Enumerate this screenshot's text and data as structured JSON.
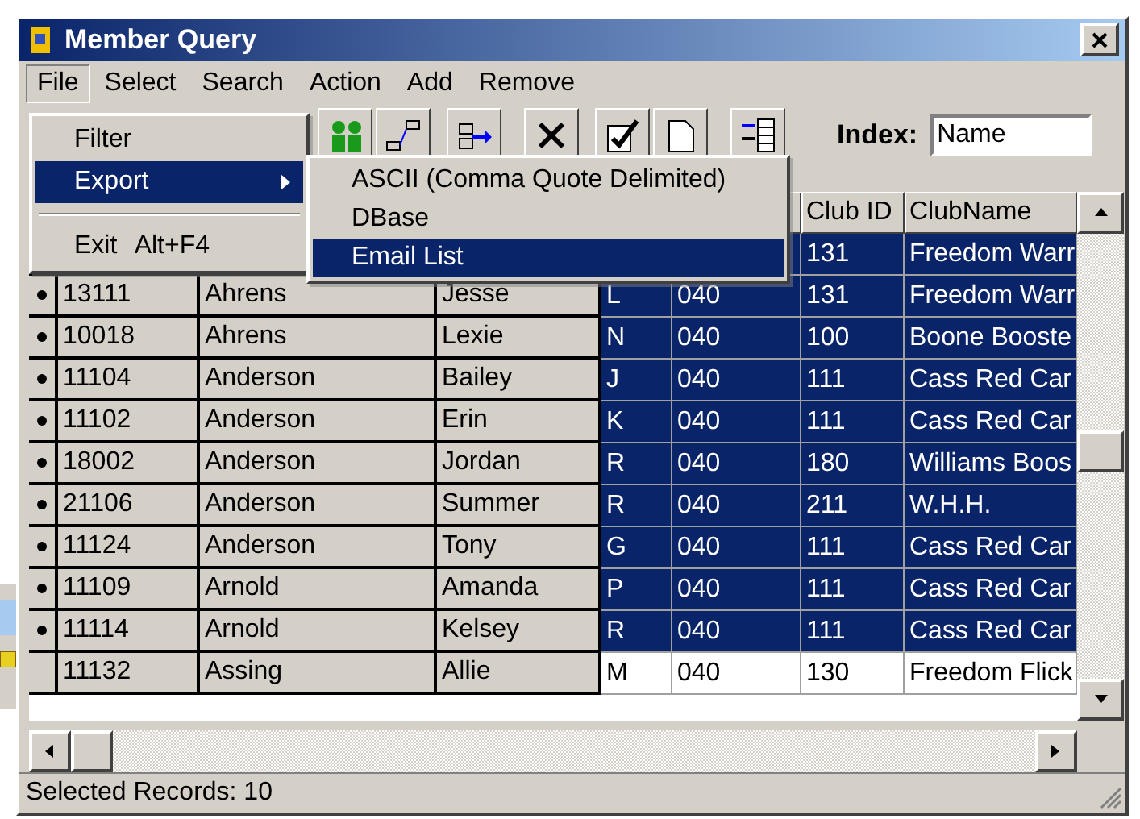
{
  "window": {
    "title": "Member Query"
  },
  "menu_bar": {
    "items": [
      {
        "label": "File",
        "selected": true
      },
      {
        "label": "Select",
        "selected": false
      },
      {
        "label": "Search",
        "selected": false
      },
      {
        "label": "Action",
        "selected": false
      },
      {
        "label": "Add",
        "selected": false
      },
      {
        "label": "Remove",
        "selected": false
      }
    ]
  },
  "file_menu": {
    "items": [
      {
        "kind": "item",
        "label": "Filter",
        "selected": false
      },
      {
        "kind": "submenu",
        "label": "Export",
        "selected": true
      },
      {
        "kind": "separator"
      },
      {
        "kind": "item",
        "label": "Exit",
        "shortcut": "Alt+F4",
        "selected": false
      }
    ]
  },
  "export_submenu": {
    "items": [
      {
        "label": "ASCII (Comma Quote Delimited)",
        "selected": false
      },
      {
        "label": "DBase",
        "selected": false
      },
      {
        "label": "Email List",
        "selected": true
      }
    ]
  },
  "toolbar": {
    "index_label": "Index:",
    "index_value": "Name"
  },
  "grid": {
    "columns": {
      "column_6": "Club ID",
      "column_7": "ClubName"
    },
    "rows": [
      {
        "selected": true,
        "column_6": "131",
        "column_7": "Freedom Warr"
      },
      {
        "marked": true,
        "selected": true,
        "column_1": "13111",
        "column_2": "Ahrens",
        "column_3": "Jesse",
        "column_4": "L",
        "column_5": "040",
        "column_6": "131",
        "column_7": "Freedom Warr"
      },
      {
        "marked": true,
        "selected": true,
        "column_1": "10018",
        "column_2": "Ahrens",
        "column_3": "Lexie",
        "column_4": "N",
        "column_5": "040",
        "column_6": "100",
        "column_7": "Boone Booste"
      },
      {
        "marked": true,
        "selected": true,
        "column_1": "11104",
        "column_2": "Anderson",
        "column_3": "Bailey",
        "column_4": "J",
        "column_5": "040",
        "column_6": "111",
        "column_7": "Cass Red Car"
      },
      {
        "marked": true,
        "selected": true,
        "column_1": "11102",
        "column_2": "Anderson",
        "column_3": "Erin",
        "column_4": "K",
        "column_5": "040",
        "column_6": "111",
        "column_7": "Cass Red Car"
      },
      {
        "marked": true,
        "selected": true,
        "column_1": "18002",
        "column_2": "Anderson",
        "column_3": "Jordan",
        "column_4": "R",
        "column_5": "040",
        "column_6": "180",
        "column_7": "Williams Boos"
      },
      {
        "marked": true,
        "selected": true,
        "column_1": "21106",
        "column_2": "Anderson",
        "column_3": "Summer",
        "column_4": "R",
        "column_5": "040",
        "column_6": "211",
        "column_7": "W.H.H."
      },
      {
        "marked": true,
        "selected": true,
        "column_1": "11124",
        "column_2": "Anderson",
        "column_3": "Tony",
        "column_4": "G",
        "column_5": "040",
        "column_6": "111",
        "column_7": "Cass Red Car"
      },
      {
        "marked": true,
        "selected": true,
        "column_1": "11109",
        "column_2": "Arnold",
        "column_3": "Amanda",
        "column_4": "P",
        "column_5": "040",
        "column_6": "111",
        "column_7": "Cass Red Car"
      },
      {
        "marked": true,
        "selected": true,
        "column_1": "11114",
        "column_2": "Arnold",
        "column_3": "Kelsey",
        "column_4": "R",
        "column_5": "040",
        "column_6": "111",
        "column_7": "Cass Red Car"
      },
      {
        "marked": false,
        "selected": false,
        "column_1": "11132",
        "column_2": "Assing",
        "column_3": "Allie",
        "column_4": "M",
        "column_5": "040",
        "column_6": "130",
        "column_7": "Freedom Flick"
      }
    ]
  },
  "status_bar": {
    "text": "Selected Records: 10"
  }
}
